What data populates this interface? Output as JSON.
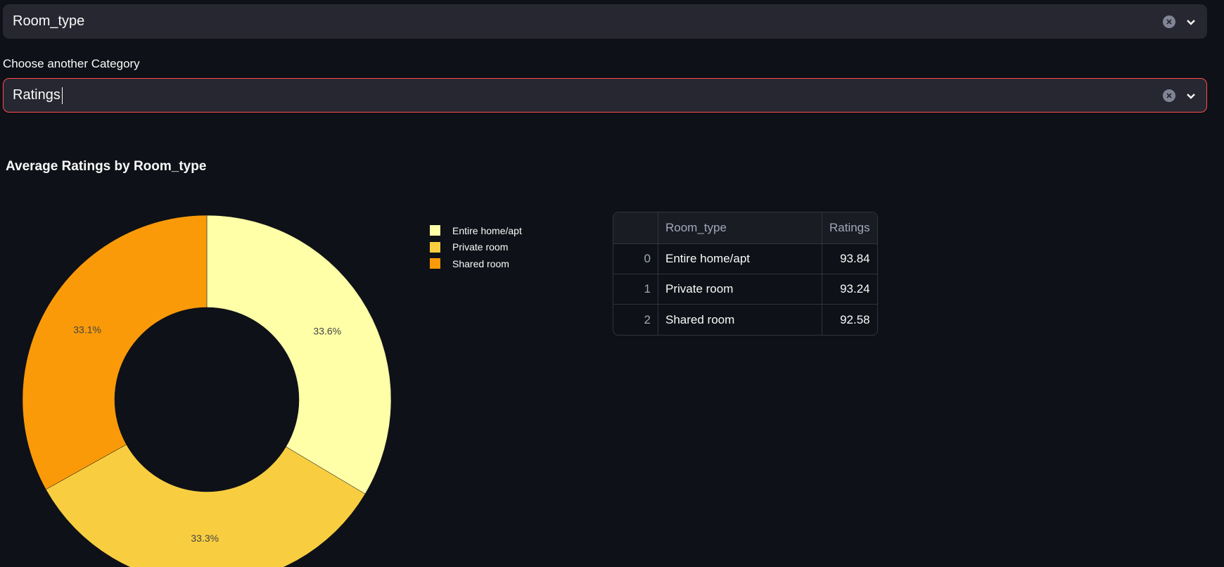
{
  "select_primary": {
    "value": "Room_type"
  },
  "select_secondary": {
    "label": "Choose another Category",
    "value": "Ratings"
  },
  "colors": {
    "background": "#0e1117",
    "focus_border": "#ff4b4b",
    "slices": [
      "#ffffa8",
      "#f8ce40",
      "#fa9a08"
    ]
  },
  "icons": {
    "clear": "clear-circle-x-icon",
    "dropdown": "chevron-down-icon"
  },
  "chart_data": {
    "type": "pie",
    "title": "Average Ratings by Room_type",
    "hole": true,
    "categories": [
      "Entire home/apt",
      "Private room",
      "Shared room"
    ],
    "values": [
      93.84,
      93.24,
      92.58
    ],
    "percent_labels": [
      "33.6%",
      "33.3%",
      "33.1%"
    ],
    "legend_position": "right"
  },
  "table": {
    "columns": [
      "",
      "Room_type",
      "Ratings"
    ],
    "rows": [
      {
        "index": "0",
        "room_type": "Entire home/apt",
        "ratings": "93.84"
      },
      {
        "index": "1",
        "room_type": "Private room",
        "ratings": "93.24"
      },
      {
        "index": "2",
        "room_type": "Shared room",
        "ratings": "92.58"
      }
    ]
  }
}
